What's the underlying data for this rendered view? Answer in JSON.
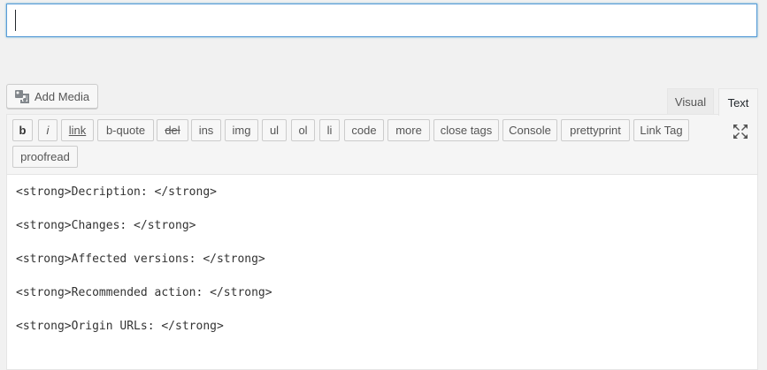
{
  "title_input": {
    "value": ""
  },
  "media": {
    "add_media_label": "Add Media"
  },
  "tabs": {
    "visual": "Visual",
    "text": "Text"
  },
  "toolbar": {
    "buttons": [
      "b",
      "i",
      "link",
      "b-quote",
      "del",
      "ins",
      "img",
      "ul",
      "ol",
      "li",
      "code",
      "more",
      "close tags",
      "Console",
      "prettyprint",
      "Link Tag",
      "proofread"
    ],
    "fullscreen_icon": "fullscreen-icon"
  },
  "content": {
    "lines": [
      "<strong>Decription: </strong>",
      "<strong>Changes: </strong>",
      "<strong>Affected versions: </strong>",
      "<strong>Recommended action: </strong>",
      "<strong>Origin URLs: </strong>"
    ]
  },
  "colors": {
    "focus_border": "#5b9dd9",
    "background": "#f1f1f1"
  }
}
